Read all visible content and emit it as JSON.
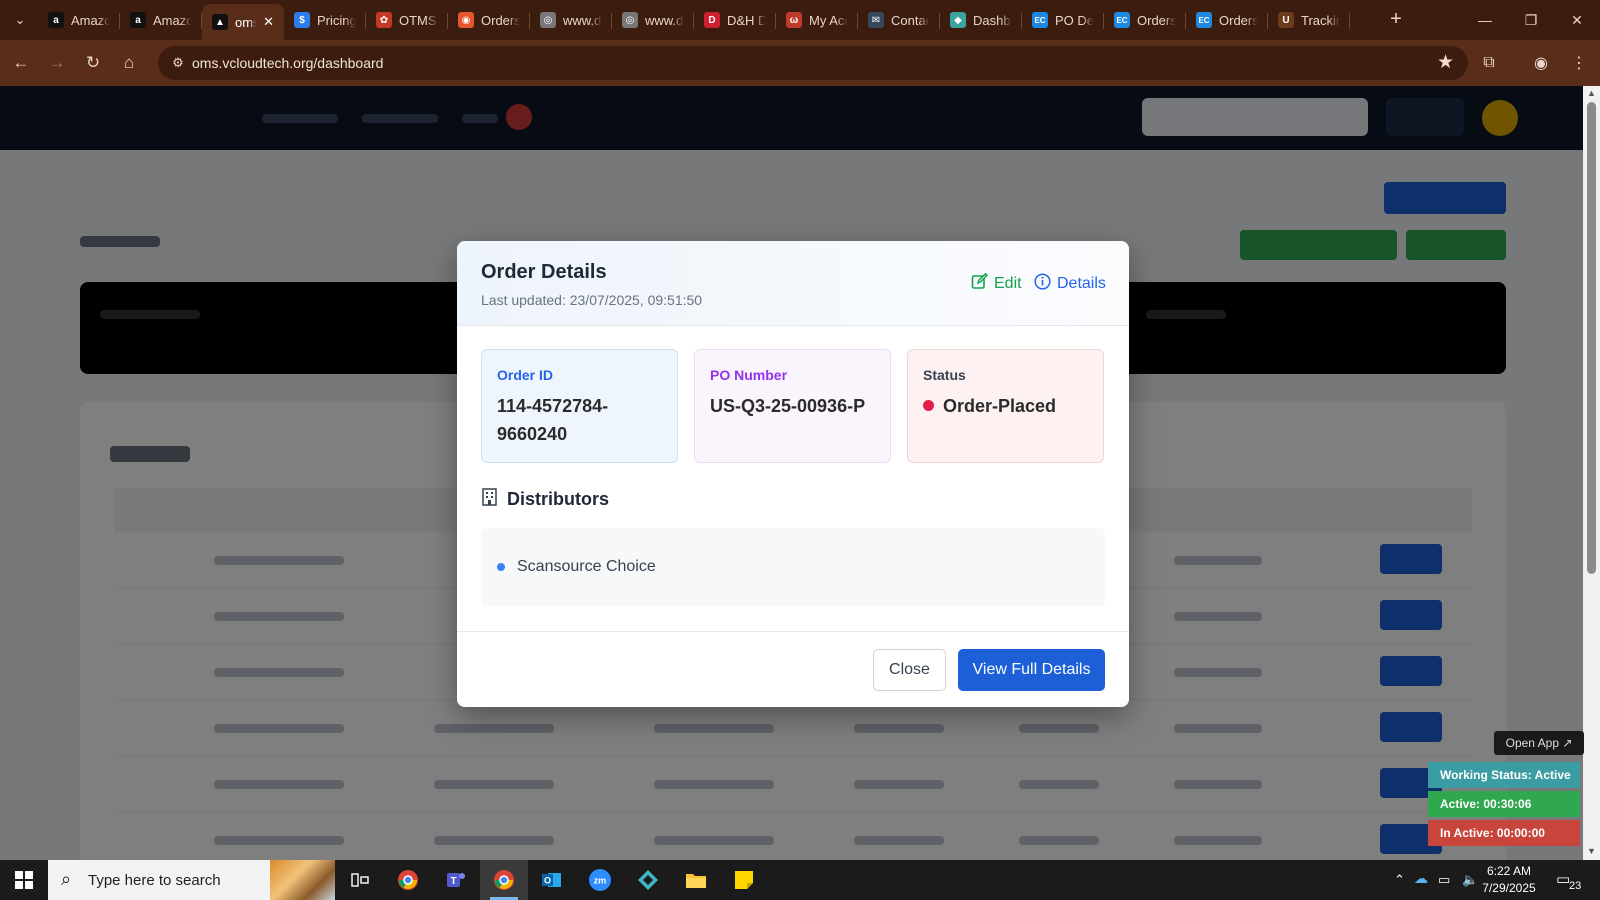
{
  "browser": {
    "tabs": [
      {
        "title": "Amazon",
        "favicon": "amazon-icon",
        "color": "#111111",
        "glyph": "a"
      },
      {
        "title": "Amazon",
        "favicon": "amazon-icon",
        "color": "#111111",
        "glyph": "a"
      },
      {
        "title": "oms",
        "favicon": "oms-icon",
        "color": "#111111",
        "glyph": "▲",
        "active": true
      },
      {
        "title": "Pricing",
        "favicon": "dollar-icon",
        "color": "#2b7de9",
        "glyph": "$"
      },
      {
        "title": "OTMS",
        "favicon": "otms-icon",
        "color": "#c0392b",
        "glyph": "✿"
      },
      {
        "title": "Orders",
        "favicon": "orders-icon",
        "color": "#e4572e",
        "glyph": "◉"
      },
      {
        "title": "www.d",
        "favicon": "globe-icon",
        "color": "#777777",
        "glyph": "◎"
      },
      {
        "title": "www.d",
        "favicon": "globe-icon",
        "color": "#777777",
        "glyph": "◎"
      },
      {
        "title": "D&H D",
        "favicon": "dh-icon",
        "color": "#d11f2f",
        "glyph": "D"
      },
      {
        "title": "My Acc",
        "favicon": "myaccount-icon",
        "color": "#c0392b",
        "glyph": "ω"
      },
      {
        "title": "Contac",
        "favicon": "mail-icon",
        "color": "#34495e",
        "glyph": "✉"
      },
      {
        "title": "Dashb",
        "favicon": "dashboard-icon",
        "color": "#3aa3a0",
        "glyph": "◆"
      },
      {
        "title": "PO Det",
        "favicon": "ec-icon",
        "color": "#1e88e5",
        "glyph": "EC"
      },
      {
        "title": "Orders",
        "favicon": "ec-icon",
        "color": "#1e88e5",
        "glyph": "EC"
      },
      {
        "title": "Orders",
        "favicon": "ec-icon",
        "color": "#1e88e5",
        "glyph": "EC"
      },
      {
        "title": "Trackin",
        "favicon": "ups-icon",
        "color": "#6b3b1a",
        "glyph": "U"
      }
    ],
    "url": "oms.vcloudtech.org/dashboard"
  },
  "modal": {
    "title": "Order Details",
    "last_updated": "Last updated: 23/07/2025, 09:51:50",
    "edit_label": "Edit",
    "details_label": "Details",
    "order_id_label": "Order ID",
    "order_id": "114-4572784-9660240",
    "po_label": "PO Number",
    "po_number": "US-Q3-25-00936-P",
    "status_label": "Status",
    "status": "Order-Placed",
    "distributors_title": "Distributors",
    "distributors": [
      "Scansource Choice"
    ],
    "close_label": "Close",
    "view_label": "View Full Details"
  },
  "work_status": {
    "open_app": "Open App ↗",
    "working": "Working Status: Active",
    "active": "Active: 00:30:06",
    "inactive": "In Active: 00:00:00"
  },
  "taskbar": {
    "search_placeholder": "Type here to search",
    "time": "6:22 AM",
    "date": "7/29/2025",
    "notifications": "23"
  },
  "colors": {
    "primary": "#1d5fd6",
    "edit_green": "#16a34a",
    "status_red": "#e11d48",
    "active_green": "#2fa84f",
    "inactive_red": "#c8453b",
    "working_teal": "#3c9ca3"
  }
}
